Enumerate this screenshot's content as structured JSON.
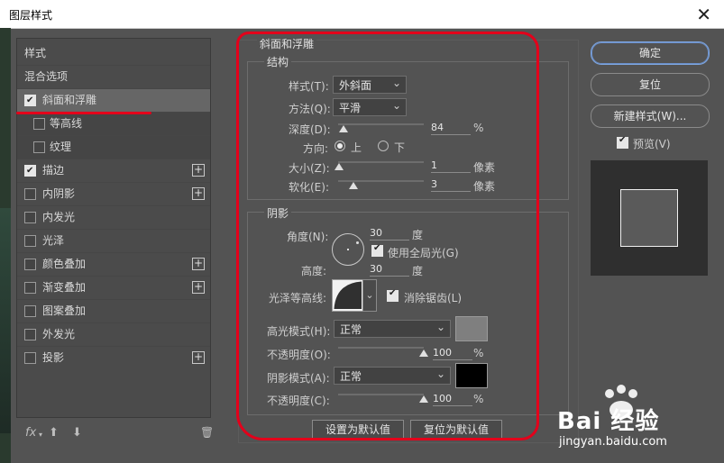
{
  "window": {
    "title": "图层样式",
    "close_label": "✕"
  },
  "left_panel": {
    "items": [
      {
        "label": "样式",
        "kind": "header"
      },
      {
        "label": "混合选项",
        "kind": "header"
      },
      {
        "label": "斜面和浮雕",
        "checked": true,
        "selected": true
      },
      {
        "label": "等高线",
        "checked": false,
        "sub": true
      },
      {
        "label": "纹理",
        "checked": false,
        "sub": true
      },
      {
        "label": "描边",
        "checked": true,
        "plus": true
      },
      {
        "label": "内阴影",
        "checked": false,
        "plus": true
      },
      {
        "label": "内发光",
        "checked": false
      },
      {
        "label": "光泽",
        "checked": false
      },
      {
        "label": "颜色叠加",
        "checked": false,
        "plus": true
      },
      {
        "label": "渐变叠加",
        "checked": false,
        "plus": true
      },
      {
        "label": "图案叠加",
        "checked": false
      },
      {
        "label": "外发光",
        "checked": false
      },
      {
        "label": "投影",
        "checked": false,
        "plus": true
      }
    ],
    "footer": {
      "fx": "fx",
      "fx_arrow": "▾",
      "up": "⬆",
      "down": "⬇",
      "trash": "🗑"
    }
  },
  "bevel": {
    "title": "斜面和浮雕",
    "structure": {
      "title": "结构",
      "style_label": "样式(T):",
      "style_value": "外斜面",
      "method_label": "方法(Q):",
      "method_value": "平滑",
      "depth_label": "深度(D):",
      "depth_value": "84",
      "depth_unit": "%",
      "direction_label": "方向:",
      "dir_up": "上",
      "dir_down": "下",
      "size_label": "大小(Z):",
      "size_value": "1",
      "size_unit": "像素",
      "soften_label": "软化(E):",
      "soften_value": "3",
      "soften_unit": "像素"
    },
    "shading": {
      "title": "阴影",
      "angle_label": "角度(N):",
      "angle_value": "30",
      "angle_unit": "度",
      "global_light_label": "使用全局光(G)",
      "altitude_label": "高度:",
      "altitude_value": "30",
      "altitude_unit": "度",
      "gloss_label": "光泽等高线:",
      "antialias_label": "消除锯齿(L)",
      "highlight_mode_label": "高光模式(H):",
      "highlight_mode_value": "正常",
      "highlight_color": "#7f7f7f",
      "highlight_opacity_label": "不透明度(O):",
      "highlight_opacity_value": "100",
      "highlight_opacity_unit": "%",
      "shadow_mode_label": "阴影模式(A):",
      "shadow_mode_value": "正常",
      "shadow_color": "#000000",
      "shadow_opacity_label": "不透明度(C):",
      "shadow_opacity_value": "100",
      "shadow_opacity_unit": "%"
    },
    "buttons": {
      "set_default": "设置为默认值",
      "reset_default": "复位为默认值"
    }
  },
  "right_panel": {
    "ok": "确定",
    "reset": "复位",
    "new_style": "新建样式(W)...",
    "preview_label": "预览(V)"
  },
  "watermark": {
    "brand": "Bai 经验",
    "url": "jingyan.baidu.com"
  }
}
